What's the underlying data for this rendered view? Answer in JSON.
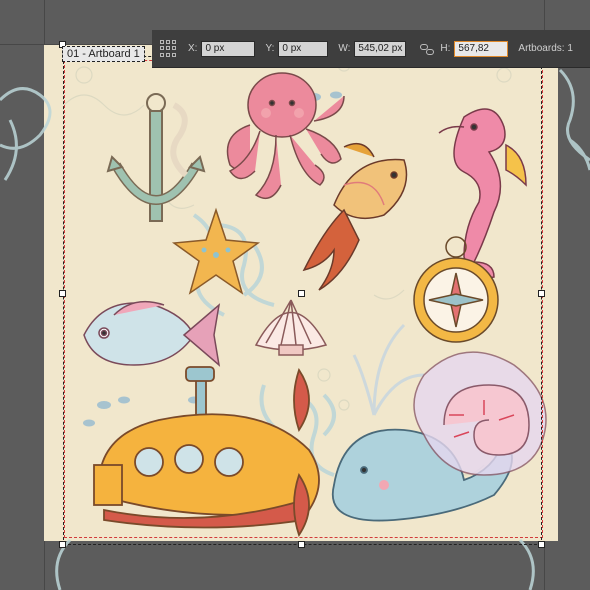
{
  "artboard": {
    "name": "01 - Artboard 1"
  },
  "control_bar": {
    "x_label": "X:",
    "x_value": "0 px",
    "y_label": "Y:",
    "y_value": "0 px",
    "w_label": "W:",
    "w_value": "545,02 px",
    "h_label": "H:",
    "h_value": "567,82",
    "artboards_label": "Artboards: 1"
  },
  "colors": {
    "pasteboard": "#5c5c5c",
    "artboard_bg": "#f1e7cc",
    "toolbar_bg": "#3e3e3e",
    "active_field_border": "#e08a2b",
    "artboard_bounds": "#d23b3b"
  },
  "icons": [
    "artboard-grid-icon",
    "constrain-link-icon"
  ]
}
